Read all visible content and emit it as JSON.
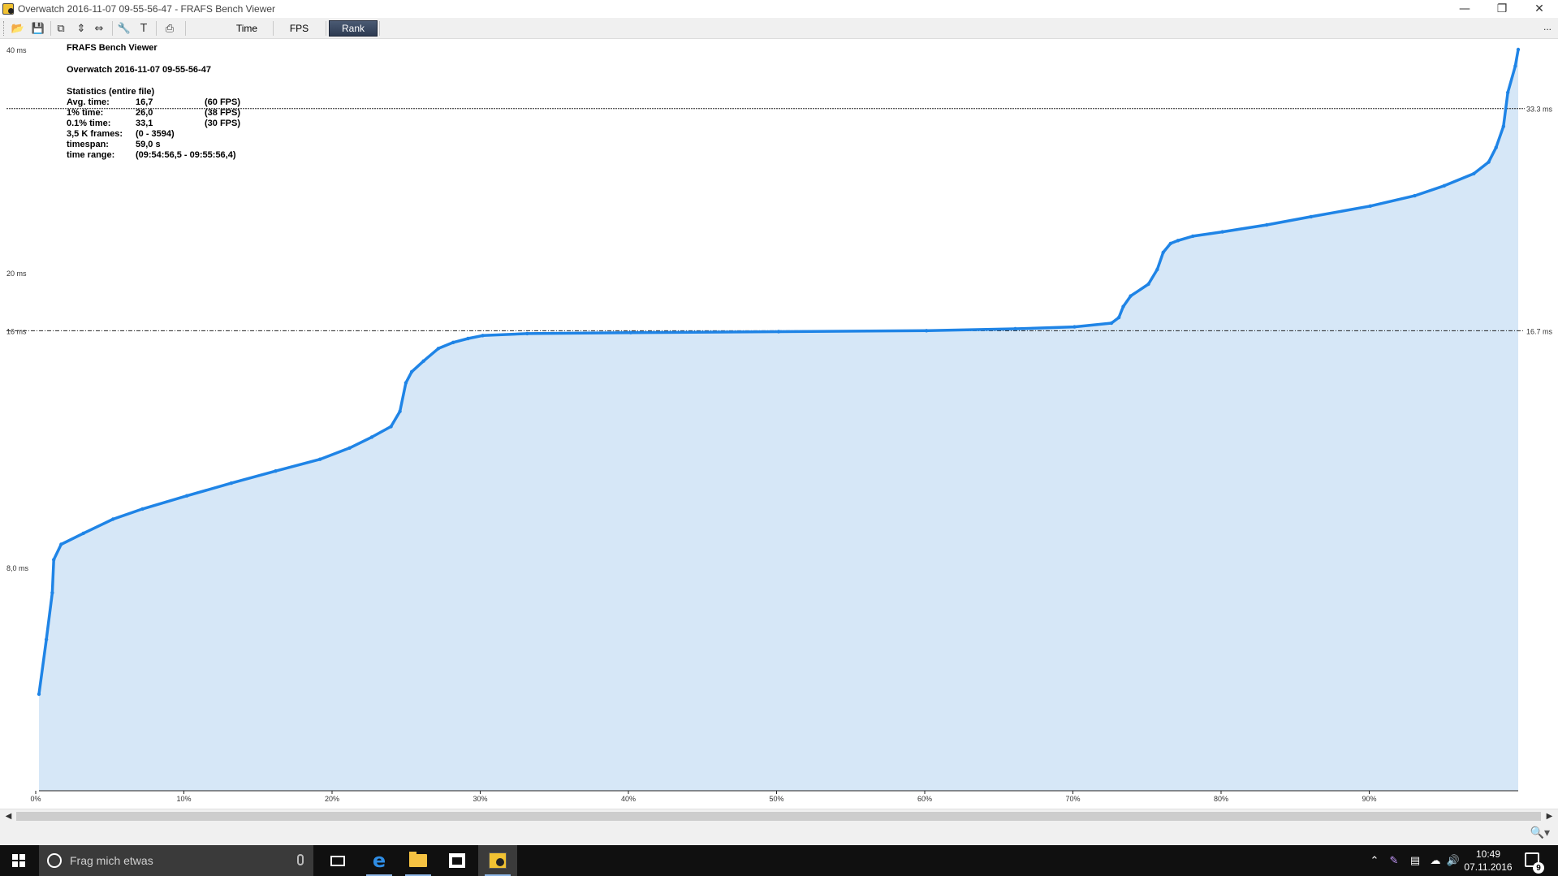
{
  "window": {
    "title": "Overwatch 2016-11-07 09-55-56-47 - FRAFS Bench Viewer",
    "minimize_glyph": "—",
    "restore_glyph": "❐",
    "close_glyph": "✕"
  },
  "toolbar": {
    "icons": [
      "open-icon",
      "save-icon",
      "copy-icon",
      "fit-height-icon",
      "fit-width-icon",
      "settings-icon",
      "text-icon",
      "print-icon"
    ],
    "tabs": [
      {
        "label": "Time",
        "active": false
      },
      {
        "label": "FPS",
        "active": false
      },
      {
        "label": "Rank",
        "active": true
      }
    ],
    "more_label": "..."
  },
  "stats_panel": {
    "app_name": "FRAFS Bench Viewer",
    "file_name": "Overwatch 2016-11-07 09-55-56-47",
    "section_title": "Statistics (entire file)",
    "rows": [
      {
        "label": "Avg. time:",
        "value": "16,7",
        "extra": "(60 FPS)"
      },
      {
        "label": "1% time:",
        "value": "26,0",
        "extra": "(38 FPS)"
      },
      {
        "label": "0.1% time:",
        "value": "33,1",
        "extra": "(30 FPS)"
      },
      {
        "label": "3,5 K frames:",
        "value": "(0 - 3594)",
        "extra": ""
      },
      {
        "label": "timespan:",
        "value": "59,0 s",
        "extra": ""
      },
      {
        "label": "time range:",
        "value": "(09:54:56,5 - 09:55:56,4)",
        "extra": ""
      }
    ]
  },
  "chart_data": {
    "type": "area",
    "title": "",
    "x_scale": "linear",
    "y_scale": "log",
    "xlim": [
      0,
      100
    ],
    "ylim": [
      4.0,
      40
    ],
    "y_ticks": [
      {
        "value": 40,
        "label": "40 ms"
      },
      {
        "value": 20,
        "label": "20 ms"
      },
      {
        "value": 16.7,
        "label": "16 ms"
      },
      {
        "value": 8.0,
        "label": "8,0 ms"
      }
    ],
    "x_ticks": [
      "0%",
      "10%",
      "20%",
      "30%",
      "40%",
      "50%",
      "60%",
      "70%",
      "80%",
      "90%"
    ],
    "reference_lines": [
      {
        "value": 33.3,
        "label": "33.3 ms"
      },
      {
        "value": 16.7,
        "label": "16.7 ms"
      }
    ],
    "series": [
      {
        "x": [
          0,
          0.5,
          0.9,
          1.0,
          1.5,
          3,
          5,
          7,
          10,
          13,
          16,
          19,
          21,
          22.5,
          23.8,
          24.4,
          24.8,
          25.2,
          26,
          27,
          28,
          29,
          30,
          33,
          40,
          50,
          60,
          66,
          70,
          72.5,
          73,
          73.3,
          73.8,
          75,
          75.6,
          76,
          76.5,
          77,
          78,
          80,
          83,
          86,
          90,
          93,
          95,
          97,
          98,
          98.5,
          99,
          99.3,
          99.8,
          100
        ],
        "y": [
          5.4,
          6.4,
          7.4,
          8.2,
          8.6,
          8.9,
          9.3,
          9.6,
          10.0,
          10.4,
          10.8,
          11.2,
          11.6,
          12.0,
          12.4,
          13.0,
          14.2,
          14.7,
          15.2,
          15.8,
          16.1,
          16.3,
          16.45,
          16.55,
          16.6,
          16.65,
          16.7,
          16.8,
          16.9,
          17.1,
          17.4,
          18.0,
          18.6,
          19.3,
          20.2,
          21.3,
          21.9,
          22.1,
          22.4,
          22.7,
          23.2,
          23.8,
          24.6,
          25.4,
          26.2,
          27.2,
          28.2,
          29.5,
          31.5,
          35.0,
          38.0,
          40.0
        ]
      }
    ]
  },
  "taskbar": {
    "search_placeholder": "Frag mich etwas",
    "time": "10:49",
    "date": "07.11.2016",
    "notification_count": "9",
    "tray_icons": [
      "chevron-up-icon",
      "pen-icon",
      "network-icon",
      "cloud-icon",
      "volume-icon"
    ]
  },
  "colors": {
    "series_line": "#1f84e6",
    "series_fill": "#d6e7f7",
    "active_tab": "#2e3b52"
  }
}
